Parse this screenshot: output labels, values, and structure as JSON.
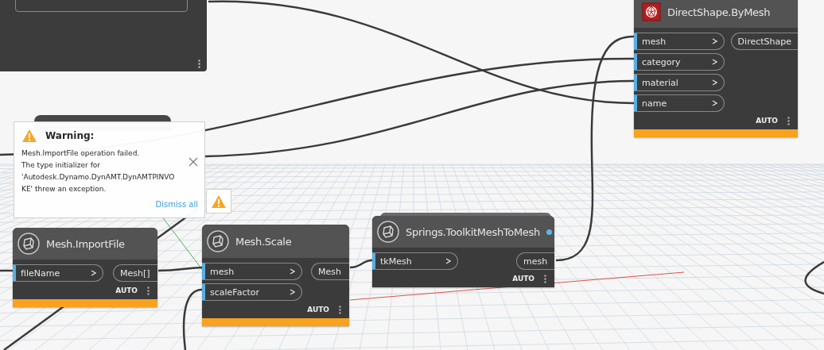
{
  "nodes": [
    {
      "title": "DirectShape.ByMesh",
      "kind": "revit",
      "info_dot": false,
      "inputs": [
        "mesh",
        "category",
        "material",
        "name"
      ],
      "outputs": [
        "DirectShape"
      ],
      "run_mode": "AUTO",
      "warning": true
    },
    {
      "title": "Mesh.ImportFile",
      "kind": "mesh",
      "info_dot": false,
      "inputs": [
        "fileName"
      ],
      "outputs": [
        "Mesh[]"
      ],
      "run_mode": "AUTO",
      "warning": true
    },
    {
      "title": "Mesh.Scale",
      "kind": "mesh",
      "info_dot": false,
      "inputs": [
        "mesh",
        "scaleFactor"
      ],
      "outputs": [
        "Mesh"
      ],
      "run_mode": "AUTO",
      "warning": true
    },
    {
      "title": "Springs.ToolkitMeshToMesh",
      "kind": "mesh",
      "info_dot": true,
      "inputs": [
        "tkMesh"
      ],
      "outputs": [
        "mesh"
      ],
      "run_mode": "AUTO",
      "warning": false
    }
  ],
  "warning_popup": {
    "title": "Warning:",
    "message": "Mesh.ImportFile operation failed.\nThe type initializer for\n'Autodesk.Dynamo.DynAMT.DynAMTPINVO\nKE' threw an exception.",
    "dismiss": "Dismiss all"
  }
}
